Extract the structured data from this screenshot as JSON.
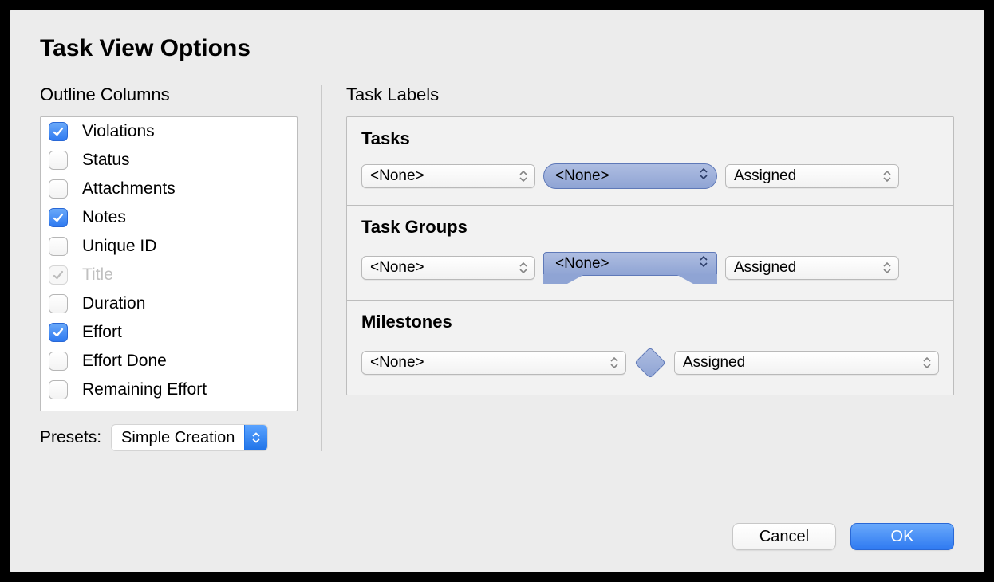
{
  "title": "Task View Options",
  "outline": {
    "heading": "Outline Columns",
    "items": [
      {
        "label": "Violations",
        "checked": true,
        "disabled": false
      },
      {
        "label": "Status",
        "checked": false,
        "disabled": false
      },
      {
        "label": "Attachments",
        "checked": false,
        "disabled": false
      },
      {
        "label": "Notes",
        "checked": true,
        "disabled": false
      },
      {
        "label": "Unique ID",
        "checked": false,
        "disabled": false
      },
      {
        "label": "Title",
        "checked": true,
        "disabled": true
      },
      {
        "label": "Duration",
        "checked": false,
        "disabled": false
      },
      {
        "label": "Effort",
        "checked": true,
        "disabled": false
      },
      {
        "label": "Effort Done",
        "checked": false,
        "disabled": false
      },
      {
        "label": "Remaining Effort",
        "checked": false,
        "disabled": false
      }
    ],
    "presets_label": "Presets:",
    "presets_value": "Simple Creation"
  },
  "task_labels": {
    "heading": "Task Labels",
    "sections": {
      "tasks": {
        "title": "Tasks",
        "left": "<None>",
        "middle": "<None>",
        "right": "Assigned"
      },
      "groups": {
        "title": "Task Groups",
        "left": "<None>",
        "middle": "<None>",
        "right": "Assigned"
      },
      "milestones": {
        "title": "Milestones",
        "left": "<None>",
        "right": "Assigned"
      }
    }
  },
  "buttons": {
    "cancel": "Cancel",
    "ok": "OK"
  }
}
